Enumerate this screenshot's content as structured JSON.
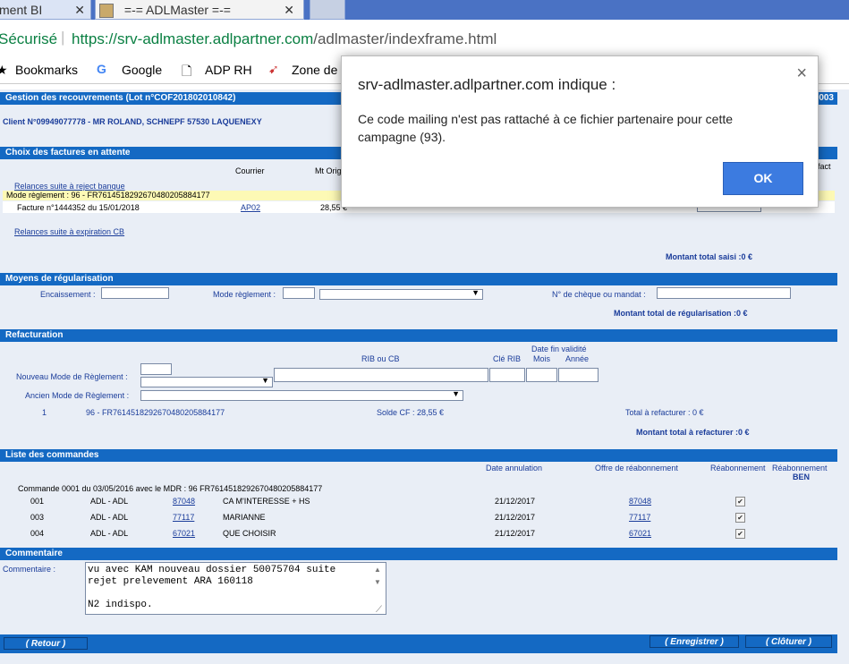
{
  "browser": {
    "tab1_title": "ment BI",
    "tab2_title": "=-= ADLMaster =-=",
    "security_label": "Sécurisé",
    "url_scheme_host": "https://srv-adlmaster.adlpartner.com",
    "url_path": "/adlmaster/indexframe.html",
    "bookmarks": [
      "Bookmarks",
      "Google",
      "ADP RH",
      "Zone de"
    ]
  },
  "dialog": {
    "title": "srv-adlmaster.adlpartner.com indique :",
    "message": "Ce code mailing n'est pas rattaché à ce fichier partenaire pour cette campagne (93).",
    "ok_label": "OK",
    "close_glyph": "×"
  },
  "header": {
    "title": "Gestion des recouvrements (Lot n°COF201802010842)",
    "right_code": "003",
    "client": "Client N°09949077778 - MR ROLAND, SCHNEPF 57530 LAQUENEXY"
  },
  "factures": {
    "section_title": "Choix des factures en attente",
    "col_courrier": "Courrier",
    "col_mt": "Mt Orig",
    "col_fact": "fact",
    "link_relances_rejet": "Relances suite à reject banque",
    "mode_reglement": "Mode règlement : 96 - FR7614518292670480205884177",
    "row_facture": "Facture n°1444352 du 15/01/2018",
    "row_courrier": "AP02",
    "row_mt": "28,55 €",
    "link_relances_cb": "Relances suite à expiration CB",
    "total_saisi": "Montant total saisi :0 €"
  },
  "moyens": {
    "section_title": "Moyens de régularisation",
    "encaissement_label": "Encaissement :",
    "mode_label": "Mode règlement :",
    "cheque_label": "N° de chèque ou mandat :",
    "total": "Montant total de régularisation :0 €"
  },
  "refacturation": {
    "section_title": "Refacturation",
    "rib_label": "RIB ou CB",
    "cle_rib": "Clé RIB",
    "date_fin": "Date fin validité",
    "mois": "Mois",
    "annee": "Année",
    "nouveau_label": "Nouveau Mode de Règlement :",
    "ancien_label": "Ancien Mode de Règlement :",
    "line_num": "1",
    "line_mode": "96 - FR7614518292670480205884177",
    "solde": "Solde CF : 28,55 €",
    "total_a_refacturer": "Total à refacturer : 0 €",
    "montant_total": "Montant total à refacturer :0 €"
  },
  "commandes": {
    "section_title": "Liste des commandes",
    "col_date_annulation": "Date annulation",
    "col_offre": "Offre de réabonnement",
    "col_reabo": "Réabonnement",
    "col_reabo_ben1": "Réabonnement",
    "col_reabo_ben2": "BEN",
    "commande_header": "Commande 0001 du 03/05/2016 avec le MDR : 96 FR7614518292670480205884177",
    "rows": [
      {
        "num": "001",
        "adl": "ADL - ADL",
        "code": "87048",
        "titre": "CA M'INTERESSE + HS",
        "date": "21/12/2017",
        "offre": "87048"
      },
      {
        "num": "003",
        "adl": "ADL - ADL",
        "code": "77117",
        "titre": "MARIANNE",
        "date": "21/12/2017",
        "offre": "77117"
      },
      {
        "num": "004",
        "adl": "ADL - ADL",
        "code": "67021",
        "titre": "QUE CHOISIR",
        "date": "21/12/2017",
        "offre": "67021"
      }
    ]
  },
  "commentaire": {
    "section_title": "Commentaire",
    "label": "Commentaire :",
    "text": "vu avec KAM nouveau dossier 50075704 suite\nrejet prelevement ARA 160118\n\nN2 indispo."
  },
  "footer": {
    "retour": "( Retour )",
    "enregistrer": "( Enregistrer )",
    "cloturer": "( Clôturer )"
  }
}
